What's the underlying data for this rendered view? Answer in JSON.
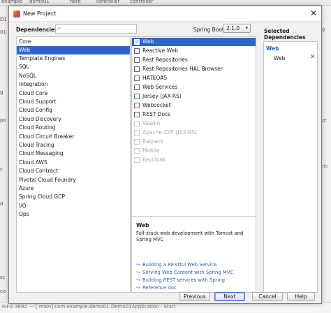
{
  "background": {
    "tabs": [
      "example",
      "demo01",
      "here",
      "controller",
      "controller"
    ],
    "left_labels": [
      "D1",
      "01",
      "g",
      "po",
      "s",
      "d",
      "sc",
      "co"
    ],
    "right_labels": [
      "ig",
      "ge",
      "ole"
    ],
    "console_text": "INFO 3892 --- [ main] com.example.demo01.Demo01Application : Start"
  },
  "dialog": {
    "title": "New Project",
    "dependencies_label": "Dependencies",
    "search": {
      "value": "",
      "placeholder": ""
    },
    "spring_boot_label": "Spring Boot",
    "spring_boot_version": "2.1.0",
    "selected_label": "Selected Dependencies"
  },
  "categories": [
    "Core",
    "Web",
    "Template Engines",
    "SQL",
    "NoSQL",
    "Integration",
    "Cloud Core",
    "Cloud Support",
    "Cloud Config",
    "Cloud Discovery",
    "Cloud Routing",
    "Cloud Circuit Breaker",
    "Cloud Tracing",
    "Cloud Messaging",
    "Cloud AWS",
    "Cloud Contract",
    "Pivotal Cloud Foundry",
    "Azure",
    "Spring Cloud GCP",
    "I/O",
    "Ops"
  ],
  "selected_category": "Web",
  "dependencies": [
    {
      "label": "Web",
      "checked": true,
      "disabled": false
    },
    {
      "label": "Reactive Web",
      "checked": false,
      "disabled": false
    },
    {
      "label": "Rest Repositories",
      "checked": false,
      "disabled": false
    },
    {
      "label": "Rest Repositories HAL Browser",
      "checked": false,
      "disabled": false
    },
    {
      "label": "HATEOAS",
      "checked": false,
      "disabled": false
    },
    {
      "label": "Web Services",
      "checked": false,
      "disabled": false
    },
    {
      "label": "Jersey (JAX-RS)",
      "checked": false,
      "disabled": false
    },
    {
      "label": "Websocket",
      "checked": false,
      "disabled": false
    },
    {
      "label": "REST Docs",
      "checked": false,
      "disabled": false
    },
    {
      "label": "Vaadin",
      "checked": false,
      "disabled": true
    },
    {
      "label": "Apache CXF (JAX-RS)",
      "checked": false,
      "disabled": true
    },
    {
      "label": "Ratpack",
      "checked": false,
      "disabled": true
    },
    {
      "label": "Mobile",
      "checked": false,
      "disabled": true
    },
    {
      "label": "Keycloak",
      "checked": false,
      "disabled": true
    }
  ],
  "description": {
    "title": "Web",
    "text": "Full-stack web development with Tomcat and Spring MVC",
    "guides": [
      "Building a RESTful Web Service",
      "Serving Web Content with Spring MVC",
      "Building REST services with Spring",
      "Reference doc"
    ]
  },
  "selected": {
    "category": "Web",
    "items": [
      "Web"
    ],
    "remove_glyph": "✕"
  },
  "buttons": {
    "previous": "Previous",
    "next": "Next",
    "cancel": "Cancel",
    "help": "Help"
  }
}
